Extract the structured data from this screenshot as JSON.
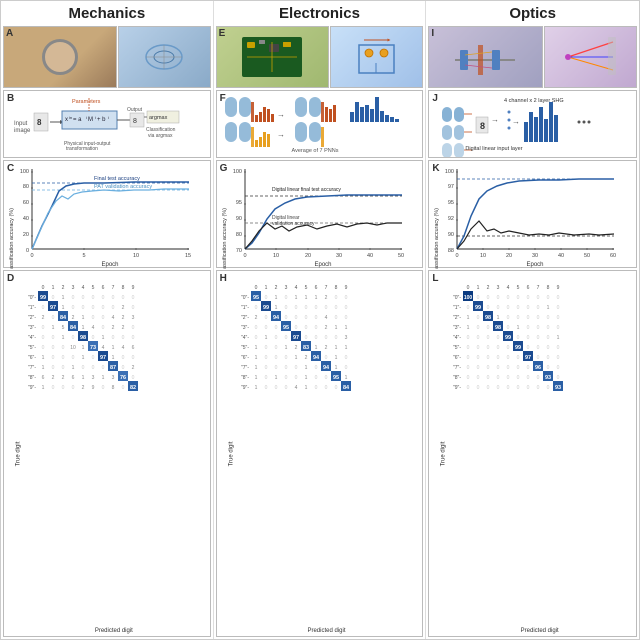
{
  "columns": [
    {
      "id": "mechanics",
      "header": "Mechanics",
      "panel_label_a": "A",
      "panel_label_b": "B",
      "panel_label_c": "C",
      "panel_label_d": "D",
      "diagram_b_text": "Input image / Physical input-output transformation / Classification via argmax / Output / Parameters",
      "chart_c": {
        "y_label": "Classification accuracy (%)",
        "x_label": "Epoch",
        "x_max": 15,
        "y_max": 100,
        "annotations": [
          "Final test accuracy",
          "PAT validation accuracy"
        ]
      },
      "matrix_d": {
        "y_label": "True digit",
        "x_label": "Predicted digit",
        "values": [
          [
            99,
            0,
            1,
            0,
            0,
            0,
            0,
            0,
            0,
            0
          ],
          [
            0,
            97,
            1,
            0,
            0,
            0,
            0,
            0,
            2,
            0
          ],
          [
            2,
            0,
            84,
            2,
            1,
            0,
            0,
            4,
            2,
            3
          ],
          [
            0,
            1,
            5,
            84,
            1,
            4,
            0,
            2,
            2,
            0
          ],
          [
            0,
            0,
            1,
            0,
            98,
            0,
            1,
            0,
            0,
            0
          ],
          [
            0,
            0,
            0,
            10,
            1,
            73,
            4,
            1,
            4,
            6
          ],
          [
            1,
            0,
            0,
            0,
            1,
            0,
            97,
            1,
            0,
            0
          ],
          [
            1,
            0,
            0,
            1,
            0,
            0,
            0,
            87,
            0,
            2
          ],
          [
            6,
            2,
            2,
            6,
            1,
            3,
            1,
            3,
            76,
            0
          ],
          [
            1,
            0,
            0,
            0,
            2,
            9,
            0,
            8,
            0,
            82
          ]
        ]
      }
    },
    {
      "id": "electronics",
      "header": "Electronics",
      "panel_label_e": "E",
      "panel_label_f": "F",
      "panel_label_g": "G",
      "panel_label_h": "H",
      "diagram_f_text": "Average of 7 PNNs",
      "chart_g": {
        "y_label": "Classification accuracy (%)",
        "x_label": "Epoch",
        "x_max": 50,
        "y_max": 100,
        "annotations": [
          "Digital linear final test accuracy",
          "Digital linear validation accuracy"
        ]
      },
      "matrix_h": {
        "y_label": "True digit",
        "x_label": "Predicted digit",
        "values": [
          [
            95,
            0,
            1,
            0,
            1,
            1,
            1,
            2,
            0,
            0
          ],
          [
            0,
            99,
            1,
            0,
            0,
            0,
            0,
            0,
            0,
            0
          ],
          [
            2,
            0,
            94,
            0,
            0,
            0,
            0,
            4,
            0,
            0
          ],
          [
            0,
            0,
            0,
            95,
            0,
            0,
            0,
            2,
            1,
            1
          ],
          [
            0,
            1,
            0,
            0,
            97,
            0,
            0,
            0,
            0,
            3
          ],
          [
            1,
            0,
            0,
            1,
            2,
            83,
            1,
            2,
            1,
            1
          ],
          [
            1,
            0,
            0,
            0,
            1,
            2,
            94,
            0,
            1,
            0
          ],
          [
            1,
            0,
            0,
            0,
            0,
            1,
            0,
            94,
            1,
            0
          ],
          [
            1,
            0,
            1,
            0,
            0,
            1,
            0,
            0,
            95,
            1
          ],
          [
            1,
            0,
            0,
            0,
            4,
            1,
            0,
            0,
            0,
            84
          ]
        ]
      }
    },
    {
      "id": "optics",
      "header": "Optics",
      "panel_label_i": "I",
      "panel_label_j": "J",
      "panel_label_k": "K",
      "panel_label_l": "L",
      "diagram_j_text": "4 channel x 2 layer SHG / Digital linear input layer",
      "chart_k": {
        "y_label": "Classification accuracy (%)",
        "x_label": "Epoch",
        "x_max": 60,
        "y_max": 100,
        "annotations": []
      },
      "matrix_l": {
        "y_label": "True digit",
        "x_label": "Predicted digit",
        "values": [
          [
            100,
            0,
            0,
            0,
            0,
            0,
            0,
            0,
            0,
            0
          ],
          [
            0,
            99,
            0,
            0,
            0,
            0,
            0,
            0,
            1,
            0
          ],
          [
            1,
            0,
            98,
            1,
            0,
            0,
            0,
            0,
            0,
            0
          ],
          [
            1,
            0,
            0,
            98,
            0,
            1,
            0,
            0,
            0,
            0
          ],
          [
            0,
            0,
            0,
            0,
            99,
            0,
            0,
            0,
            0,
            1
          ],
          [
            0,
            0,
            0,
            0,
            0,
            99,
            0,
            0,
            0,
            0
          ],
          [
            0,
            0,
            0,
            0,
            0,
            0,
            97,
            0,
            0,
            0
          ],
          [
            0,
            0,
            0,
            0,
            0,
            0,
            0,
            96,
            0,
            0
          ],
          [
            0,
            0,
            0,
            0,
            0,
            0,
            0,
            0,
            93,
            0
          ],
          [
            0,
            0,
            0,
            0,
            0,
            0,
            0,
            0,
            0,
            93
          ]
        ]
      }
    }
  ],
  "digit_labels": [
    "0",
    "1",
    "2",
    "3",
    "4",
    "5",
    "6",
    "7",
    "8",
    "9"
  ]
}
